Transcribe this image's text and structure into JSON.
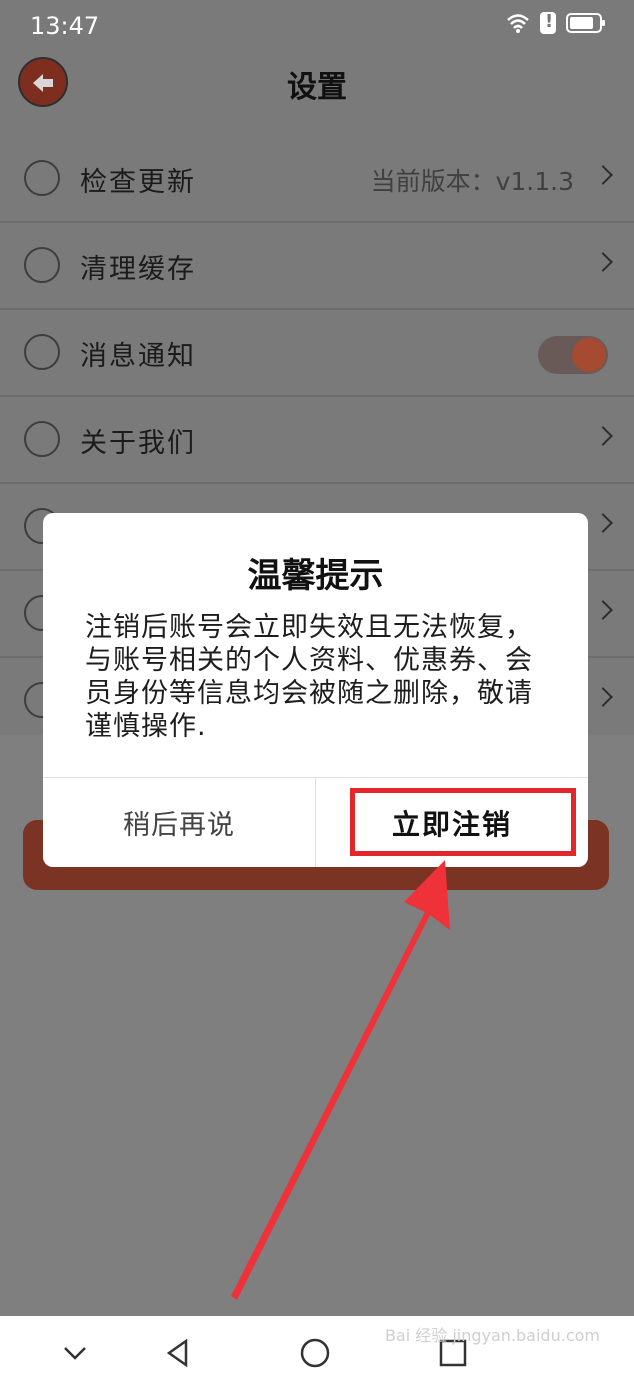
{
  "status_bar": {
    "time": "13:47"
  },
  "header": {
    "title": "设置"
  },
  "settings": {
    "items": [
      {
        "label": "检查更新",
        "value": "当前版本：v1.1.3",
        "icon": "upload-icon",
        "type": "chevron"
      },
      {
        "label": "清理缓存",
        "value": "",
        "icon": "broom-icon",
        "type": "chevron"
      },
      {
        "label": "消息通知",
        "value": "",
        "icon": "bell-icon",
        "type": "toggle",
        "on": true
      },
      {
        "label": "关于我们",
        "value": "",
        "icon": "user-icon",
        "type": "chevron"
      },
      {
        "label": "",
        "value": "",
        "icon": "document-icon",
        "type": "chevron"
      },
      {
        "label": "",
        "value": "",
        "icon": "shield-icon",
        "type": "chevron"
      },
      {
        "label": "",
        "value": "",
        "icon": "circle-icon",
        "type": "chevron"
      }
    ]
  },
  "dialog": {
    "title": "温馨提示",
    "message": "注销后账号会立即失效且无法恢复，与账号相关的个人资料、优惠券、会员身份等信息均会被随之删除，敬请谨慎操作.",
    "cancel_label": "稍后再说",
    "confirm_label": "立即注销"
  },
  "watermark": {
    "text": "Bai 经验 jingyan.baidu.com"
  },
  "colors": {
    "accent": "#a64a32",
    "highlight": "#e3262b",
    "overlay": "#7f7f7f"
  }
}
